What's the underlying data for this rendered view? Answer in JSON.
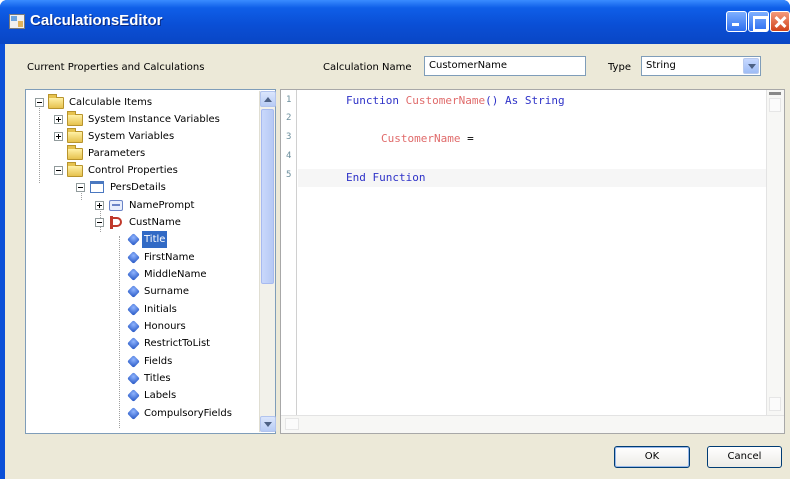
{
  "window": {
    "title": "CalculationsEditor"
  },
  "left_panel": {
    "header": "Current Properties and Calculations"
  },
  "calc_name": {
    "label": "Calculation Name",
    "value": "CustomerName"
  },
  "type": {
    "label": "Type",
    "value": "String"
  },
  "tree": {
    "items": [
      {
        "label": "Calculable Items",
        "icon": "folder-icon"
      },
      {
        "label": "System Instance Variables",
        "icon": "folder-icon"
      },
      {
        "label": "System Variables",
        "icon": "folder-icon"
      },
      {
        "label": "Parameters",
        "icon": "folder-icon"
      },
      {
        "label": "Control Properties",
        "icon": "folder-icon"
      },
      {
        "label": "PersDetails",
        "icon": "form-icon"
      },
      {
        "label": "NamePrompt",
        "icon": "label-control-icon"
      },
      {
        "label": "CustName",
        "icon": "combo-control-icon"
      },
      {
        "label": "Title",
        "icon": "property-icon",
        "selected": true
      },
      {
        "label": "FirstName",
        "icon": "property-icon"
      },
      {
        "label": "MiddleName",
        "icon": "property-icon"
      },
      {
        "label": "Surname",
        "icon": "property-icon"
      },
      {
        "label": "Initials",
        "icon": "property-icon"
      },
      {
        "label": "Honours",
        "icon": "property-icon"
      },
      {
        "label": "RestrictToList",
        "icon": "property-icon"
      },
      {
        "label": "Fields",
        "icon": "property-icon"
      },
      {
        "label": "Titles",
        "icon": "property-icon"
      },
      {
        "label": "Labels",
        "icon": "property-icon"
      },
      {
        "label": "CompulsoryFields",
        "icon": "property-icon"
      }
    ]
  },
  "editor": {
    "line_numbers": [
      "1",
      "2",
      "3",
      "4",
      "5"
    ],
    "line1": {
      "kw1": "Function",
      "name": "CustomerName",
      "rest": "()",
      "kw2": "As",
      "type": "String"
    },
    "line3": {
      "name": "CustomerName",
      "op": "="
    },
    "line5": {
      "text": "End Function"
    }
  },
  "buttons": {
    "ok": "OK",
    "cancel": "Cancel"
  },
  "colors": {
    "titlebar": "#0a4fd6",
    "keyword": "#2f33c8",
    "identifier": "#e06b6b",
    "selection": "#316ac5",
    "dialog_bg": "#ece9d8"
  }
}
